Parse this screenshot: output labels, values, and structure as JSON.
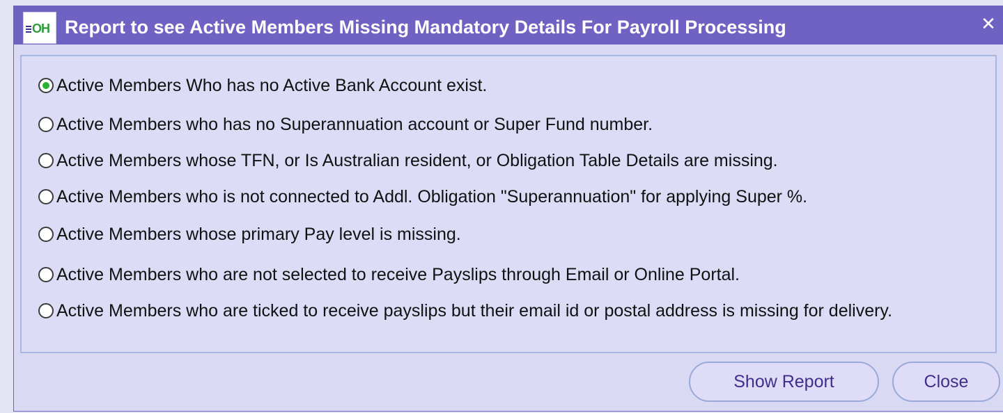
{
  "window": {
    "logo_text": "OH",
    "title": "Report to see Active Members Missing Mandatory Details For Payroll Processing",
    "close_glyph": "✕",
    "accent_color": "#6f62c2"
  },
  "options": [
    {
      "label": "Active Members Who has no Active Bank Account exist.",
      "checked": true
    },
    {
      "label": "Active Members who has no Superannuation account or Super Fund number.",
      "checked": false
    },
    {
      "label": "Active Members whose TFN, or Is Australian resident, or Obligation Table Details are missing.",
      "checked": false
    },
    {
      "label": "Active Members who is not connected to Addl. Obligation \"Superannuation\" for applying Super %.",
      "checked": false
    },
    {
      "label": "Active Members whose primary Pay level is missing.",
      "checked": false
    },
    {
      "label": "Active Members who are not selected to receive Payslips through Email or Online Portal.",
      "checked": false
    },
    {
      "label": "Active Members who are ticked to receive payslips but their email id or postal address is missing for delivery.",
      "checked": false
    }
  ],
  "buttons": {
    "show_report": "Show Report",
    "close": "Close"
  }
}
